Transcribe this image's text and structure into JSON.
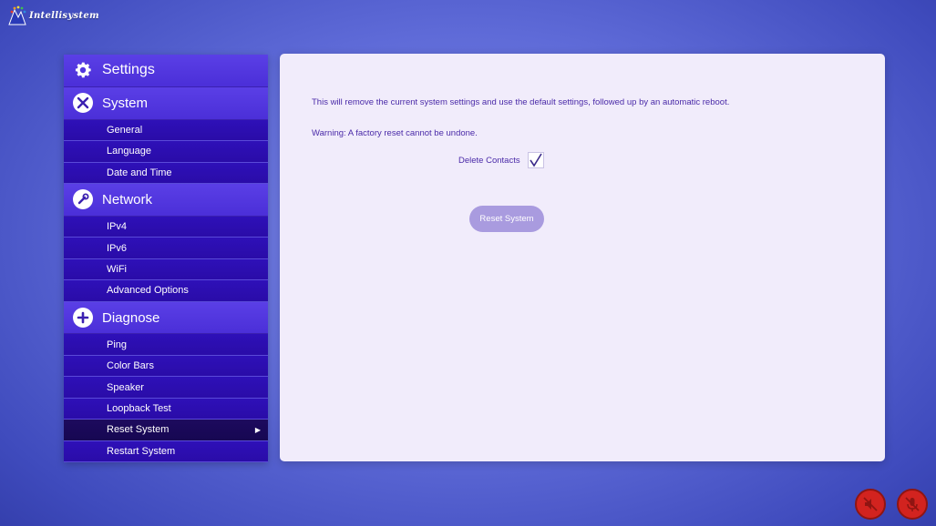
{
  "brand": {
    "logo_text": "Intellisystem"
  },
  "sidebar": {
    "title": "Settings",
    "sections": [
      {
        "label": "System",
        "icon": "tools-icon",
        "items": [
          "General",
          "Language",
          "Date and Time"
        ]
      },
      {
        "label": "Network",
        "icon": "wrench-icon",
        "items": [
          "IPv4",
          "IPv6",
          "WiFi",
          "Advanced Options"
        ]
      },
      {
        "label": "Diagnose",
        "icon": "plus-icon",
        "items": [
          "Ping",
          "Color Bars",
          "Speaker",
          "Loopback Test",
          "Reset System",
          "Restart System"
        ]
      }
    ],
    "active_item": "Reset System"
  },
  "main": {
    "description": "This will remove the current system settings and use the default settings, followed up by an automatic reboot.",
    "warning": "Warning: A factory reset cannot be undone.",
    "delete_contacts_label": "Delete Contacts",
    "delete_contacts_checked": true,
    "reset_button_label": "Reset System"
  },
  "footer": {
    "buttons": [
      {
        "name": "speaker-mute-icon",
        "state": "muted"
      },
      {
        "name": "microphone-mute-icon",
        "state": "muted"
      }
    ]
  },
  "colors": {
    "header_purple": "#5a3fe6",
    "item_purple": "#2e10b8",
    "active_item": "#1d0a5e",
    "panel_bg": "#f1ecfb",
    "text_purple": "#4a2aa8",
    "button_disabled": "#a99bdf",
    "mute_red": "#d2231f"
  }
}
